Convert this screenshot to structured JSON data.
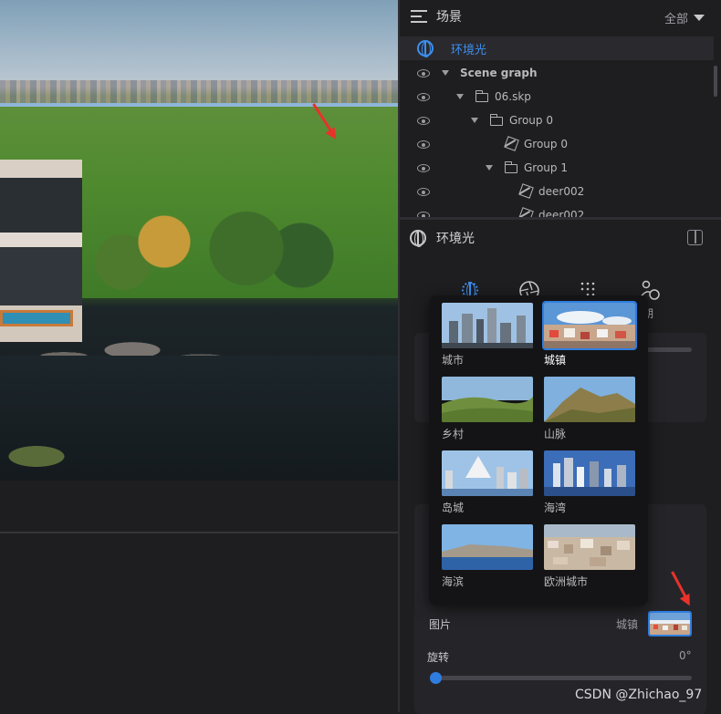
{
  "scene_panel": {
    "title": "场景",
    "filter_label": "全部",
    "tree": [
      {
        "label": "环境光",
        "type": "environment",
        "selected": true
      },
      {
        "label": "Scene graph",
        "type": "root"
      },
      {
        "label": "06.skp",
        "type": "folder"
      },
      {
        "label": "Group 0",
        "type": "folder"
      },
      {
        "label": "Group 0",
        "type": "mesh"
      },
      {
        "label": "Group 1",
        "type": "folder"
      },
      {
        "label": "deer002",
        "type": "mesh"
      },
      {
        "label": "deer002",
        "type": "mesh"
      }
    ]
  },
  "properties_panel": {
    "title": "环境光",
    "tabs": [
      {
        "icon": "environment-icon",
        "label": ""
      },
      {
        "icon": "aperture-icon",
        "label": ""
      },
      {
        "icon": "dots-grid-icon",
        "label": ""
      },
      {
        "icon": "time-icon",
        "label": "期"
      }
    ],
    "image_row": {
      "label": "图片",
      "value": "城镇"
    },
    "rotation_row": {
      "label": "旋转",
      "value": "0°",
      "level": 0
    }
  },
  "env_picker": {
    "options": [
      {
        "label": "城市",
        "selected": false
      },
      {
        "label": "城镇",
        "selected": true
      },
      {
        "label": "乡村",
        "selected": false
      },
      {
        "label": "山脉",
        "selected": false
      },
      {
        "label": "岛城",
        "selected": false
      },
      {
        "label": "海湾",
        "selected": false
      },
      {
        "label": "海滨",
        "selected": false
      },
      {
        "label": "欧洲城市",
        "selected": false
      }
    ]
  },
  "watermark": "CSDN @Zhichao_97",
  "colors": {
    "accent": "#2f7de0",
    "selected_text": "#3d8ff0",
    "annotation_arrow": "#e8322a",
    "panel_bg": "#1e1e21"
  }
}
